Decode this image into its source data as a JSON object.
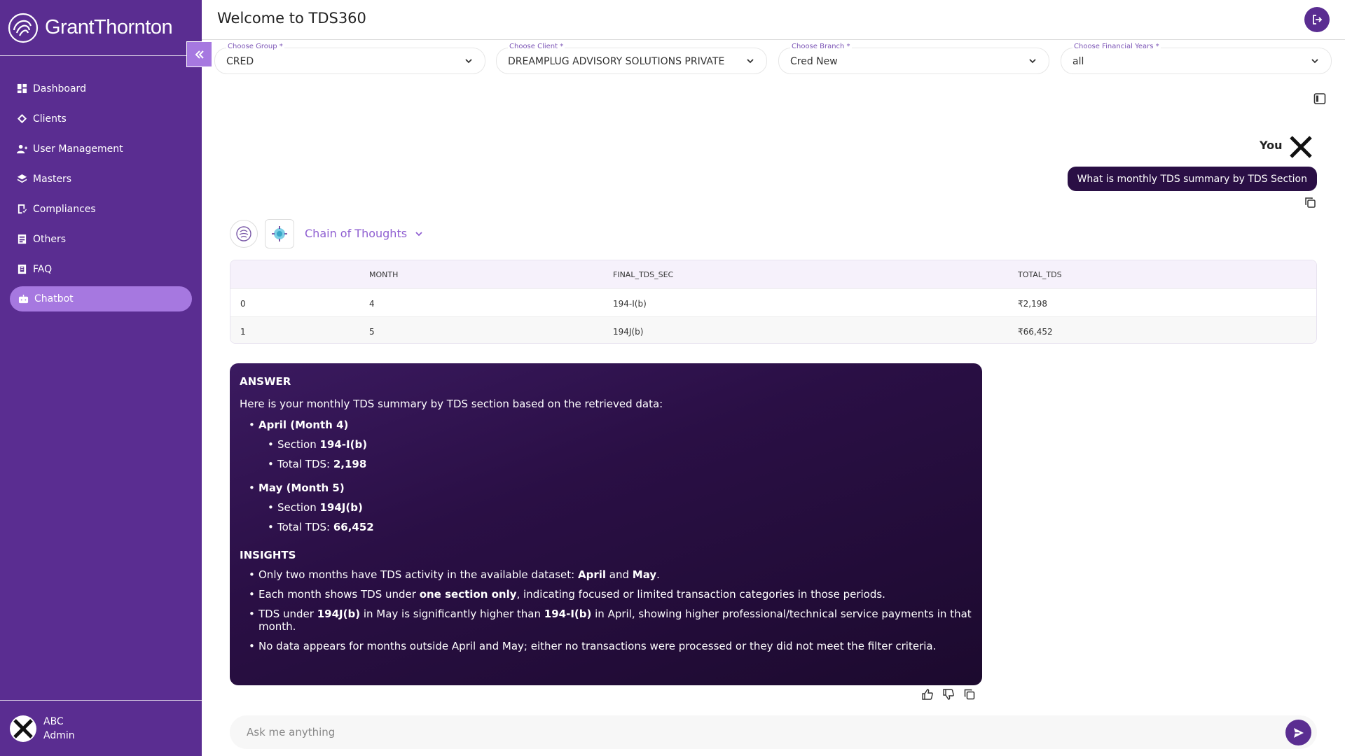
{
  "brand": {
    "name": "GrantThornton"
  },
  "sidebar": {
    "items": [
      {
        "label": "Dashboard",
        "icon": "dashboard-icon"
      },
      {
        "label": "Clients",
        "icon": "clients-icon"
      },
      {
        "label": "User Management",
        "icon": "user-management-icon"
      },
      {
        "label": "Masters",
        "icon": "masters-icon"
      },
      {
        "label": "Compliances",
        "icon": "compliances-icon"
      },
      {
        "label": "Others",
        "icon": "others-icon"
      },
      {
        "label": "FAQ",
        "icon": "faq-icon"
      },
      {
        "label": "Chatbot",
        "icon": "chatbot-icon",
        "active": true
      }
    ],
    "user": {
      "name": "ABC",
      "role": "Admin"
    }
  },
  "header": {
    "title": "Welcome to TDS360"
  },
  "filters": [
    {
      "label": "Choose Group *",
      "value": "CRED"
    },
    {
      "label": "Choose Client *",
      "value": "DREAMPLUG ADVISORY SOLUTIONS PRIVATE ..."
    },
    {
      "label": "Choose Branch *",
      "value": "Cred New"
    },
    {
      "label": "Choose Financial Years *",
      "value": "all"
    }
  ],
  "chat": {
    "you_label": "You",
    "user_message": "What is monthly TDS summary by TDS Section",
    "chain_of_thoughts": "Chain of Thoughts",
    "table": {
      "headers": [
        "",
        "MONTH",
        "FINAL_TDS_SEC",
        "TOTAL_TDS"
      ],
      "rows": [
        [
          "0",
          "4",
          "194-I(b)",
          "₹2,198"
        ],
        [
          "1",
          "5",
          "194J(b)",
          "₹66,452"
        ]
      ]
    },
    "answer": {
      "heading": "ANSWER",
      "intro": "Here is your monthly TDS summary by TDS section based on the retrieved data:",
      "months": [
        {
          "title": "April (Month 4)",
          "section_prefix": "Section ",
          "section": "194-I(b)",
          "total_prefix": "Total TDS: ",
          "total": "2,198"
        },
        {
          "title": "May (Month 5)",
          "section_prefix": "Section ",
          "section": "194J(b)",
          "total_prefix": "Total TDS: ",
          "total": "66,452"
        }
      ],
      "insights_heading": "INSIGHTS",
      "insight1_prefix": "Only two months have TDS activity in the available dataset: ",
      "insight1_b1": "April",
      "insight1_mid": " and ",
      "insight1_b2": "May",
      "insight1_end": ".",
      "insight2_prefix": "Each month shows TDS under ",
      "insight2_b": "one section only",
      "insight2_end": ", indicating focused or limited transaction categories in those periods.",
      "insight3_prefix": "TDS under ",
      "insight3_b1": "194J(b)",
      "insight3_mid": " in May is significantly higher than ",
      "insight3_b2": "194-I(b)",
      "insight3_end": " in April, showing higher professional/technical service payments in that month.",
      "insight4": "No data appears for months outside April and May; either no transactions were processed or they did not meet the filter criteria."
    },
    "input_placeholder": "Ask me anything"
  },
  "colors": {
    "sidebar": "#5a2d91",
    "accent": "#a678e0",
    "bubble": "#2a0f45"
  }
}
